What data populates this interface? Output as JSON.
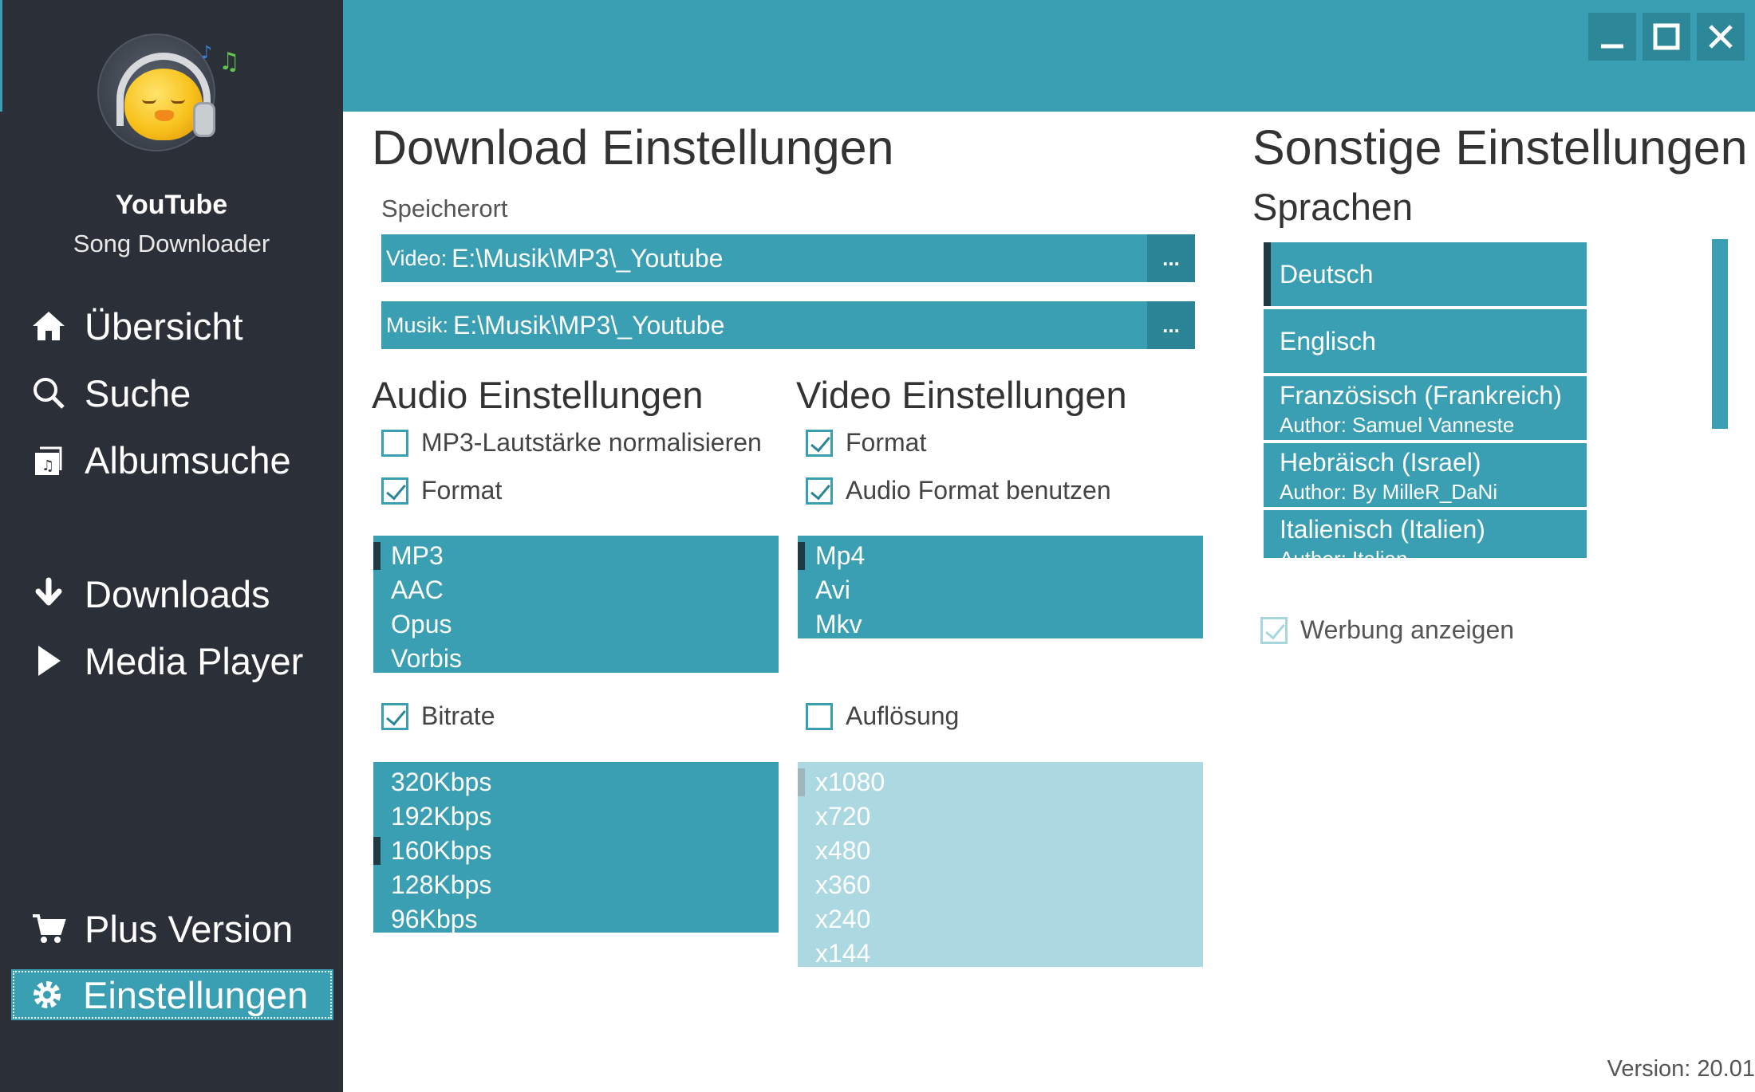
{
  "app": {
    "brand_line1": "YouTube",
    "brand_line2": "Song Downloader",
    "version_text": "Version:  20.01",
    "accent_color": "#3a9fb2",
    "sidebar_color": "#2b2f38"
  },
  "sidebar": {
    "items": [
      {
        "label": "Übersicht",
        "icon": "home-icon"
      },
      {
        "label": "Suche",
        "icon": "search-icon"
      },
      {
        "label": "Albumsuche",
        "icon": "album-search-icon"
      },
      {
        "label": "Downloads",
        "icon": "download-arrow-icon"
      },
      {
        "label": "Media Player",
        "icon": "play-icon"
      },
      {
        "label": "Plus Version",
        "icon": "cart-icon"
      },
      {
        "label": "Einstellungen",
        "icon": "gear-icon",
        "active": true
      }
    ]
  },
  "window_controls": [
    "minimize",
    "maximize",
    "close"
  ],
  "download": {
    "title": "Download Einstellungen",
    "location_label": "Speicherort",
    "video_prefix": "Video:",
    "video_path": "E:\\Musik\\MP3\\_Youtube",
    "music_prefix": "Musik:",
    "music_path": "E:\\Musik\\MP3\\_Youtube",
    "browse_label": "..."
  },
  "audio": {
    "title": "Audio Einstellungen",
    "normalize_label": "MP3-Lautstärke normalisieren",
    "normalize_checked": false,
    "format_label": "Format",
    "format_checked": true,
    "formats": [
      "MP3",
      "AAC",
      "Opus",
      "Vorbis"
    ],
    "selected_format": "MP3",
    "bitrate_label": "Bitrate",
    "bitrate_checked": true,
    "bitrates": [
      "320Kbps",
      "192Kbps",
      "160Kbps",
      "128Kbps",
      "96Kbps"
    ],
    "selected_bitrate": "160Kbps"
  },
  "video": {
    "title": "Video Einstellungen",
    "format_label": "Format",
    "format_checked": true,
    "audio_format_label": "Audio Format benutzen",
    "audio_format_checked": true,
    "formats": [
      "Mp4",
      "Avi",
      "Mkv"
    ],
    "selected_format": "Mp4",
    "resolution_label": "Auflösung",
    "resolution_checked": false,
    "resolutions": [
      "x1080",
      "x720",
      "x480",
      "x360",
      "x240",
      "x144"
    ],
    "selected_resolution": "x1080"
  },
  "other": {
    "title": "Sonstige Einstellungen",
    "languages_label": "Sprachen",
    "languages": [
      {
        "name": "Deutsch",
        "author": ""
      },
      {
        "name": "Englisch",
        "author": ""
      },
      {
        "name": "Französisch (Frankreich)",
        "author": "Author: Samuel Vanneste"
      },
      {
        "name": "Hebräisch (Israel)",
        "author": "Author: By MilleR_DaNi"
      },
      {
        "name": "Italienisch (Italien)",
        "author": "Author: Italian"
      }
    ],
    "selected_language": "Deutsch",
    "ads_label": "Werbung anzeigen",
    "ads_checked": true
  }
}
